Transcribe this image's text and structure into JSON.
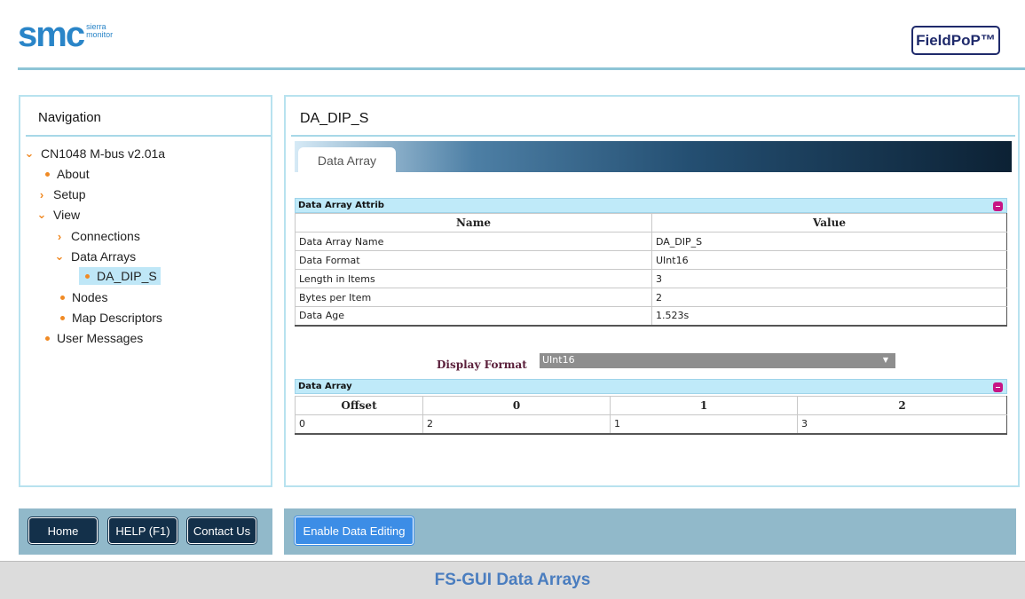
{
  "header": {
    "logo_main": "smc",
    "logo_sub_line1": "sierra",
    "logo_sub_line2": "monitor",
    "brand_label": "FieldPoP™"
  },
  "nav": {
    "title": "Navigation",
    "tree": {
      "root": "CN1048 M-bus v2.01a",
      "about": "About",
      "setup": "Setup",
      "view": "View",
      "connections": "Connections",
      "data_arrays": "Data Arrays",
      "da_dip_s": "DA_DIP_S",
      "nodes": "Nodes",
      "map_descriptors": "Map Descriptors",
      "user_messages": "User Messages"
    }
  },
  "main": {
    "title": "DA_DIP_S",
    "tab_label": "Data Array",
    "attrib": {
      "section_title": "Data Array Attrib",
      "col_name": "Name",
      "col_value": "Value",
      "rows": [
        {
          "name": "Data Array Name",
          "value": "DA_DIP_S"
        },
        {
          "name": "Data Format",
          "value": "UInt16"
        },
        {
          "name": "Length in Items",
          "value": "3"
        },
        {
          "name": "Bytes per Item",
          "value": "2"
        },
        {
          "name": "Data Age",
          "value": "1.523s"
        }
      ]
    },
    "display_format": {
      "label": "Display Format",
      "selected": "UInt16"
    },
    "array": {
      "section_title": "Data Array",
      "headers": [
        "Offset",
        "0",
        "1",
        "2"
      ],
      "row": [
        "0",
        "2",
        "1",
        "3"
      ]
    }
  },
  "footer": {
    "home": "Home",
    "help": "HELP (F1)",
    "contact": "Contact Us",
    "enable_editing": "Enable Data Editing"
  },
  "caption": "FS-GUI Data Arrays",
  "colors": {
    "accent_orange": "#f08a24",
    "panel_border": "#b8e2ef",
    "footer_bg": "#91b9ca",
    "button_dark": "#13304a",
    "button_blue": "#3c8de6",
    "caption_text": "#4a7dbf"
  }
}
